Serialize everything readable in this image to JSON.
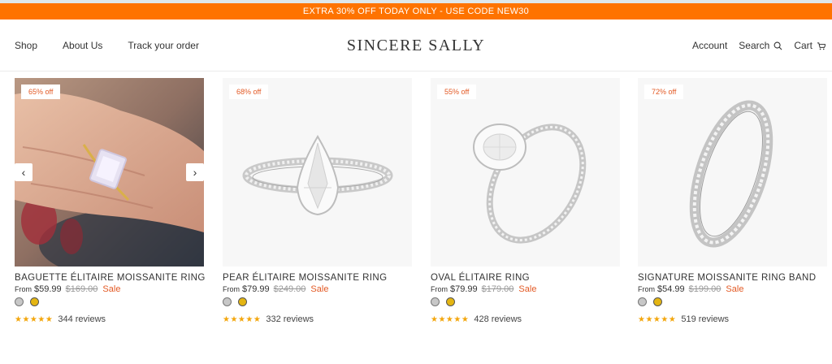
{
  "announcement": "EXTRA 30% OFF TODAY ONLY - USE CODE NEW30",
  "nav": {
    "left": [
      "Shop",
      "About Us",
      "Track your order"
    ],
    "logo": "SINCERE SALLY",
    "account": "Account",
    "search": "Search",
    "cart": "Cart"
  },
  "colors": {
    "accent": "#fe7300",
    "sale": "#e35a25",
    "star": "#f3a60c",
    "gold": "#e4b512",
    "silver": "#c7c7c7"
  },
  "products": [
    {
      "badge": "65% off",
      "title": "BAGUETTE ÉLITAIRE MOISSANITE RING",
      "from": "From",
      "price": "$59.99",
      "compare": "$169.00",
      "sale": "Sale",
      "stars": "★★★★★",
      "reviews": "344 reviews",
      "image": "hand-ring-photo"
    },
    {
      "badge": "68% off",
      "title": "PEAR ÉLITAIRE MOISSANITE RING",
      "from": "From",
      "price": "$79.99",
      "compare": "$249.00",
      "sale": "Sale",
      "stars": "★★★★★",
      "reviews": "332 reviews",
      "image": "pear-ring"
    },
    {
      "badge": "55% off",
      "title": "OVAL ÉLITAIRE RING",
      "from": "From",
      "price": "$79.99",
      "compare": "$179.00",
      "sale": "Sale",
      "stars": "★★★★★",
      "reviews": "428 reviews",
      "image": "oval-ring"
    },
    {
      "badge": "72% off",
      "title": "SIGNATURE MOISSANITE RING BAND",
      "from": "From",
      "price": "$54.99",
      "compare": "$199.00",
      "sale": "Sale",
      "stars": "★★★★★",
      "reviews": "519 reviews",
      "image": "band-ring"
    }
  ],
  "carousel": {
    "prev": "‹",
    "next": "›"
  }
}
